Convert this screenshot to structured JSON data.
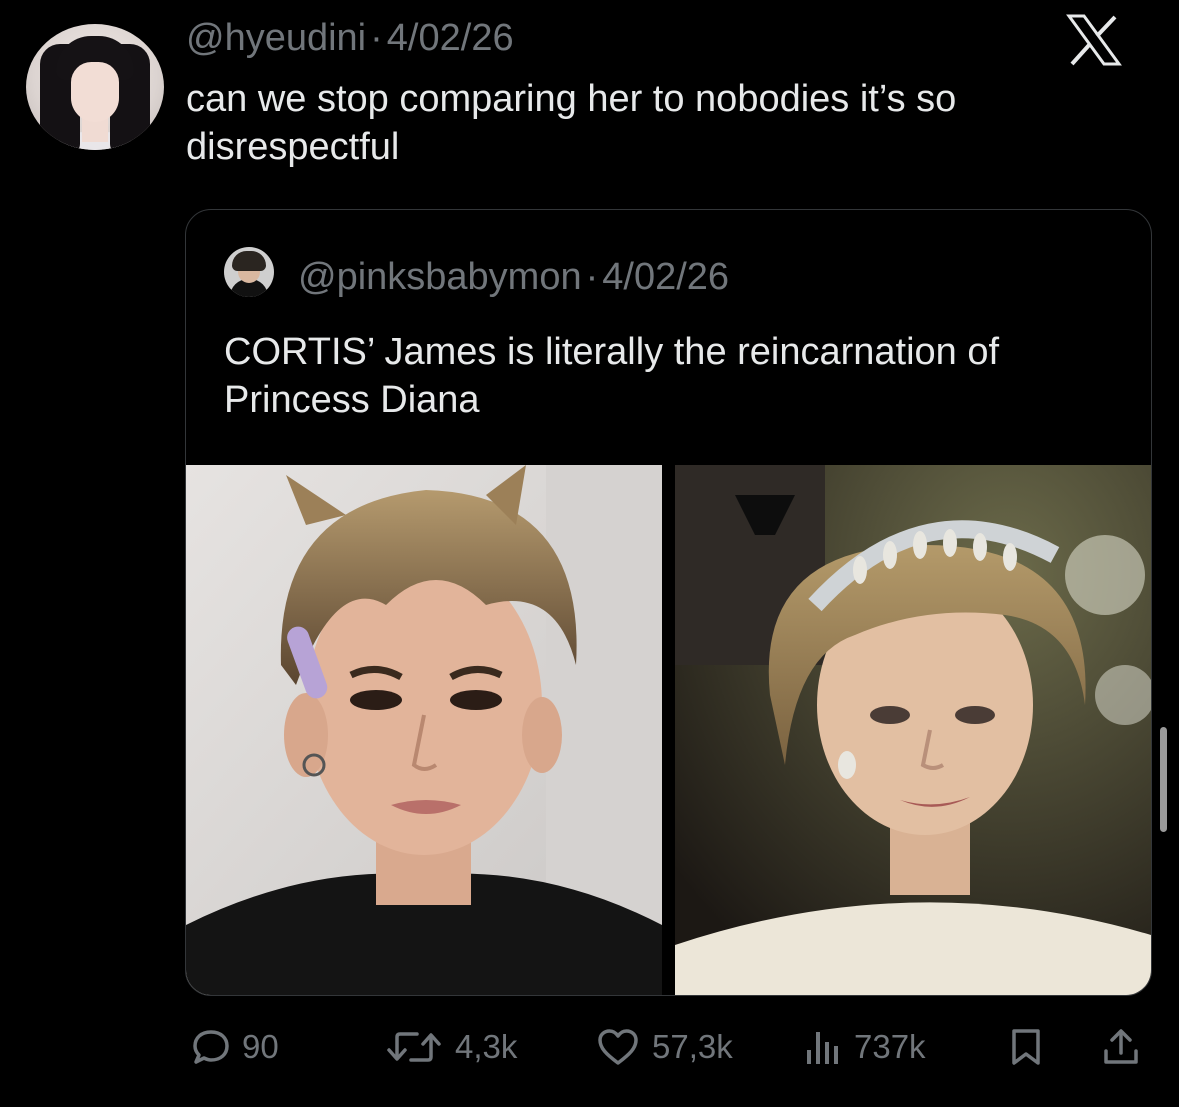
{
  "tweet": {
    "handle": "@hyeudini",
    "separator": "·",
    "date": "4/02/26",
    "text": "can we stop comparing her to nobodies it’s so disrespectful"
  },
  "quoted_tweet": {
    "handle": "@pinksbabymon",
    "separator": "·",
    "date": "4/02/26",
    "text": "CORTIS’ James is literally the reincarnation of Princess Diana"
  },
  "actions": {
    "replies": "90",
    "reposts": "4,3k",
    "likes": "57,3k",
    "views": "737k"
  },
  "icons": {
    "logo": "x-logo-icon",
    "reply": "speech-bubble-icon",
    "repost": "repost-arrows-icon",
    "like": "heart-icon",
    "views": "bar-chart-icon",
    "bookmark": "bookmark-icon",
    "share": "share-upload-icon"
  },
  "colors": {
    "background": "#000000",
    "text": "#e7e9ea",
    "secondary": "#71767b",
    "border": "#333639"
  }
}
